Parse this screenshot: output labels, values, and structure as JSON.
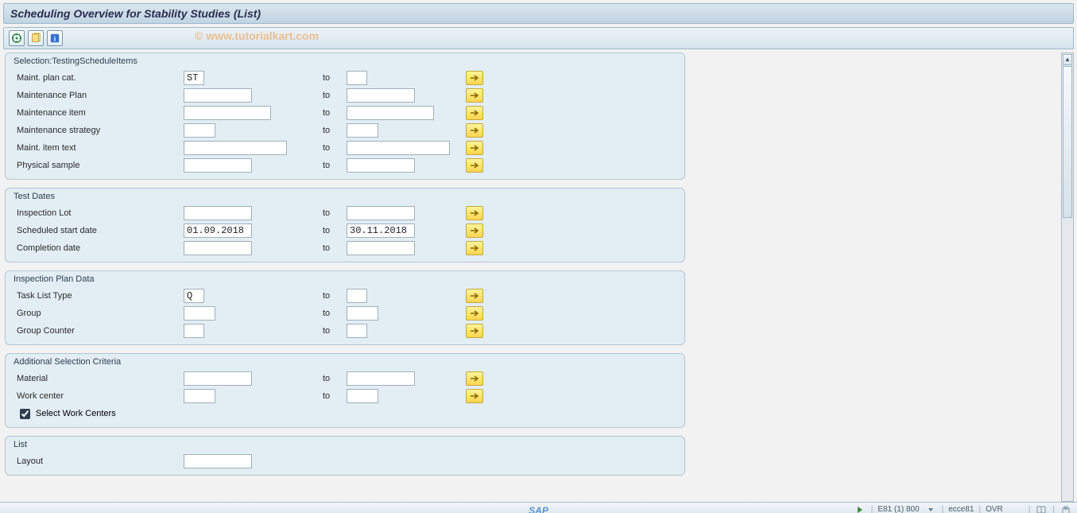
{
  "header": {
    "title": "Scheduling Overview for Stability Studies (List)"
  },
  "toolbar": {
    "execute_icon": "execute-icon",
    "variant_icon": "variant-icon",
    "info_icon": "info-icon"
  },
  "watermark": "© www.tutorialkart.com",
  "labels": {
    "to": "to"
  },
  "groups": {
    "selection": {
      "title": "Selection:TestingScheduleItems",
      "rows": {
        "maint_plan_cat": {
          "label": "Maint. plan cat.",
          "from": "ST",
          "to": ""
        },
        "maintenance_plan": {
          "label": "Maintenance Plan",
          "from": "",
          "to": ""
        },
        "maintenance_item": {
          "label": "Maintenance item",
          "from": "",
          "to": ""
        },
        "maintenance_strategy": {
          "label": "Maintenance strategy",
          "from": "",
          "to": ""
        },
        "maint_item_text": {
          "label": "Maint. item text",
          "from": "",
          "to": ""
        },
        "physical_sample": {
          "label": "Physical sample",
          "from": "",
          "to": ""
        }
      }
    },
    "test_dates": {
      "title": "Test Dates",
      "rows": {
        "inspection_lot": {
          "label": "Inspection Lot",
          "from": "",
          "to": ""
        },
        "scheduled_start": {
          "label": "Scheduled start date",
          "from": "01.09.2018",
          "to": "30.11.2018"
        },
        "completion_date": {
          "label": "Completion date",
          "from": "",
          "to": ""
        }
      }
    },
    "inspection_plan": {
      "title": "Inspection Plan Data",
      "rows": {
        "task_list_type": {
          "label": "Task List Type",
          "from": "Q",
          "to": ""
        },
        "group": {
          "label": "Group",
          "from": "",
          "to": ""
        },
        "group_counter": {
          "label": "Group Counter",
          "from": "",
          "to": ""
        }
      }
    },
    "additional": {
      "title": "Additional Selection Criteria",
      "rows": {
        "material": {
          "label": "Material",
          "from": "",
          "to": ""
        },
        "work_center": {
          "label": "Work center",
          "from": "",
          "to": ""
        }
      },
      "select_work_centers": {
        "label": "Select Work Centers",
        "checked": true
      }
    },
    "list": {
      "title": "List",
      "rows": {
        "layout": {
          "label": "Layout",
          "from": ""
        }
      }
    }
  },
  "status": {
    "sap_logo": "SAP",
    "system": "E81 (1) 800",
    "server": "ecce81",
    "mode": "OVR"
  }
}
